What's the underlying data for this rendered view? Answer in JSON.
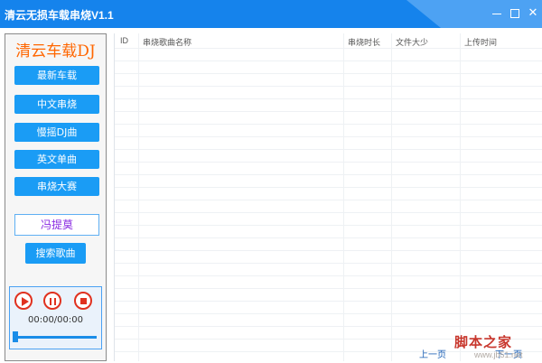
{
  "window": {
    "title": "清云无损车载串烧V1.1"
  },
  "sidebar": {
    "brand": "清云车载DJ",
    "nav": [
      {
        "label": "最新车载"
      },
      {
        "label": "中文串烧"
      },
      {
        "label": "慢摇DJ曲"
      },
      {
        "label": "英文单曲"
      },
      {
        "label": "串烧大赛"
      }
    ],
    "search_value": "冯提莫",
    "search_button": "搜索歌曲"
  },
  "player": {
    "time": "00:00/00:00",
    "progress": 0
  },
  "table": {
    "columns": [
      "ID",
      "串烧歌曲名称",
      "串烧时长",
      "文件大少",
      "上传时间"
    ],
    "rows": []
  },
  "pager": {
    "prev": "上一页",
    "next": "下一页"
  },
  "watermark": {
    "text": "脚本之家",
    "sub": "www.jb51.net"
  },
  "colors": {
    "titlebar": "#1583ec",
    "button": "#1a9cf5",
    "brand": "#ff6600",
    "player_controls": "#e0311f",
    "name_text": "#8a2be2"
  }
}
